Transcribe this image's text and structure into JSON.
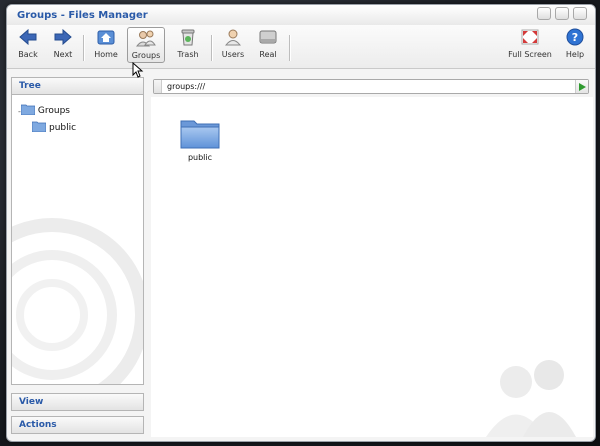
{
  "window": {
    "title": "Groups - Files Manager"
  },
  "toolbar": {
    "back_label": "Back",
    "next_label": "Next",
    "home_label": "Home",
    "groups_label": "Groups",
    "trash_label": "Trash",
    "users_label": "Users",
    "real_label": "Real",
    "fullscreen_label": "Full Screen",
    "help_label": "Help"
  },
  "sidebar": {
    "tree_title": "Tree",
    "tree_items": [
      {
        "label": "Groups",
        "expander": "-"
      },
      {
        "label": "public"
      }
    ],
    "view_title": "View",
    "actions_title": "Actions"
  },
  "pathbar": {
    "value": "groups:///"
  },
  "files": [
    {
      "name": "public",
      "icon": "folder-icon"
    }
  ],
  "colors": {
    "accent": "#2a5aa8",
    "folder": "#7fa9e0"
  }
}
